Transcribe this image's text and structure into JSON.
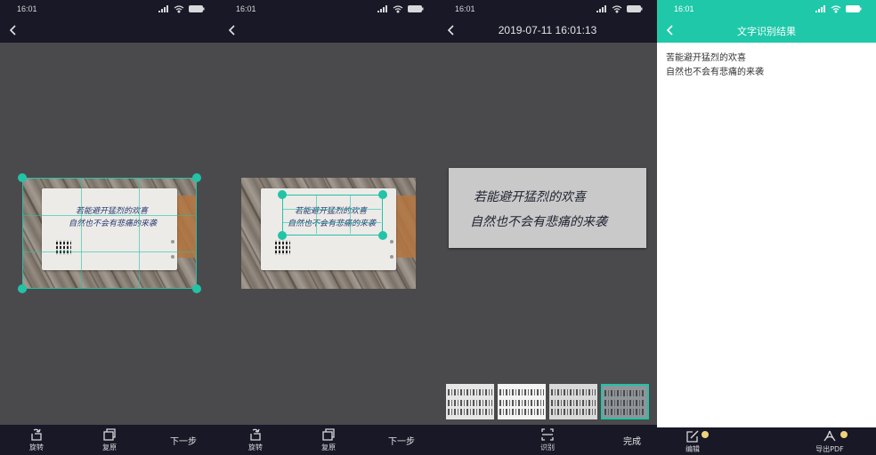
{
  "colors": {
    "accent": "#22c3a6",
    "topbar_dark": "#181826",
    "canvas_gray": "#4a4a4c",
    "header_green": "#1fc8a9"
  },
  "status": {
    "time": "16:01",
    "battery": "89"
  },
  "crop_screen": {
    "toolbar": {
      "rotate_label": "旋转",
      "restore_label": "复原",
      "next_label": "下一步"
    }
  },
  "crop_screen_2": {
    "toolbar": {
      "rotate_label": "旋转",
      "restore_label": "复原",
      "next_label": "下一步"
    }
  },
  "preview_screen": {
    "title": "2019-07-11 16:01:13",
    "toolbar": {
      "recognize_label": "识别",
      "done_label": "完成"
    }
  },
  "result_screen": {
    "title": "文字识别结果",
    "lines": [
      "苦能避开猛烈的欢喜",
      "自然也不会有悲痛的来袭"
    ],
    "toolbar": {
      "edit_label": "编辑",
      "export_label": "导出PDF"
    }
  },
  "handwriting": {
    "line1": "若能避开猛烈的欢喜",
    "line2": "自然也不会有悲痛的来袭"
  },
  "icons": [
    "back-arrow-icon",
    "rotate-icon",
    "restore-icon",
    "recognize-icon",
    "edit-icon",
    "pdf-icon",
    "signal-icon",
    "wifi-icon",
    "battery-icon"
  ]
}
